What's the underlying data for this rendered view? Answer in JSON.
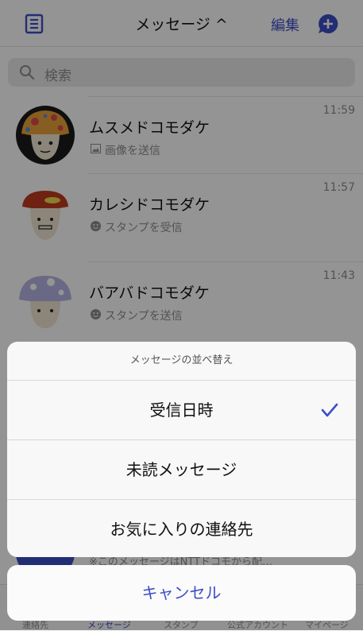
{
  "header": {
    "title": "メッセージ ^",
    "edit_label": "編集"
  },
  "search": {
    "placeholder": "検索"
  },
  "conversations": [
    {
      "name": "ムスメドコモダケ",
      "preview": "画像を送信",
      "time": "11:59",
      "preview_icon": "image-icon"
    },
    {
      "name": "カレシドコモダケ",
      "preview": "スタンプを受信",
      "time": "11:57",
      "preview_icon": "smiley-icon"
    },
    {
      "name": "バアバドコモダケ",
      "preview": "スタンプを送信",
      "time": "11:43",
      "preview_icon": "smiley-icon"
    }
  ],
  "partial_row": {
    "preview": "※このメッセージはNTTドコモから配…"
  },
  "tabbar": {
    "items": [
      "連絡先",
      "メッセージ",
      "スタンプ",
      "公式アカウント",
      "マイページ"
    ],
    "active_index": 1
  },
  "sort_sheet": {
    "title": "メッセージの並べ替え",
    "options": [
      {
        "label": "受信日時",
        "selected": true
      },
      {
        "label": "未読メッセージ",
        "selected": false
      },
      {
        "label": "お気に入りの連絡先",
        "selected": false
      }
    ],
    "cancel_label": "キャンセル"
  },
  "colors": {
    "accent": "#3d4ec7",
    "overlay": "rgba(0,0,0,0.42)"
  }
}
